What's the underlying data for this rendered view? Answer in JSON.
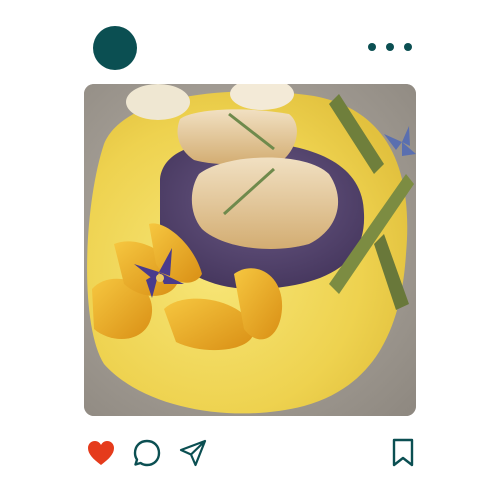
{
  "post": {
    "avatar": {
      "icon": "profile-avatar",
      "color": "#0b4f52"
    },
    "menu": {
      "icon": "more-options-icon",
      "color": "#0b4f52"
    },
    "photo": {
      "subject": "plated-dish"
    },
    "actions": {
      "like": {
        "icon": "heart-icon",
        "state": "liked",
        "color": "#e53b1c"
      },
      "comment": {
        "icon": "comment-icon",
        "color": "#0b4f52"
      },
      "share": {
        "icon": "send-icon",
        "color": "#0b4f52"
      },
      "save": {
        "icon": "bookmark-icon",
        "color": "#0b4f52"
      }
    }
  }
}
